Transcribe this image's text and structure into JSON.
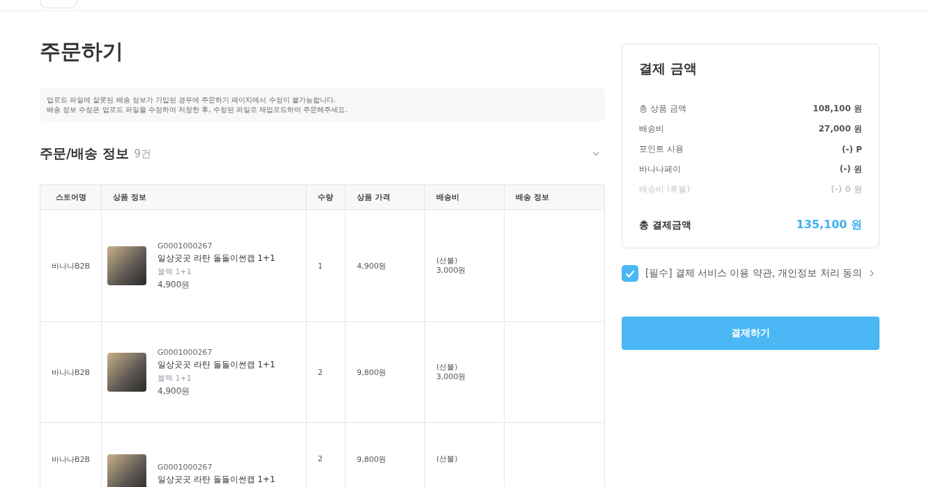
{
  "page_title": "주문하기",
  "notice": [
    "업로드 파일에 잘못된 배송 정보가 기입된 경우에 주문하기 페이지에서 수정이 불가능합니다.",
    "배송 정보 수정은 업로드 파일을 수정하여 저장한 후, 수정된 파일로 재업로드하여 주문해주세요."
  ],
  "section": {
    "title": "주문/배송 정보",
    "count": "9건",
    "expanded": true
  },
  "table": {
    "columns": [
      "스토어명",
      "상품 정보",
      "수량",
      "상품 가격",
      "배송비",
      "배송 정보"
    ],
    "rows": [
      {
        "store": "바나나B2B",
        "code": "G0001000267",
        "name": "일상곳곳 라탄 돌돌이썬캡 1+1",
        "option": "블랙 1+1",
        "unit_price": "4,900원",
        "quantity": "1",
        "price": "4,900원",
        "shipping_type": "(선불)",
        "shipping_fee": "3,000원"
      },
      {
        "store": "바나나B2B",
        "code": "G0001000267",
        "name": "일상곳곳 라탄 돌돌이썬캡 1+1",
        "option": "블랙 1+1",
        "unit_price": "4,900원",
        "quantity": "2",
        "price": "9,800원",
        "shipping_type": "(선불)",
        "shipping_fee": "3,000원"
      },
      {
        "store": "바나나B2B",
        "code": "G0001000267",
        "name": "일상곳곳 라탄 돌돌이썬캡 1+1",
        "quantity": "2",
        "price": "9,800원",
        "shipping_type": "(선불)"
      }
    ]
  },
  "summary": {
    "title": "결제 금액",
    "lines": [
      {
        "label": "총 상품 금액",
        "value": "108,100 원",
        "disabled": false
      },
      {
        "label": "배송비",
        "value": "27,000 원",
        "disabled": false
      },
      {
        "label": "포인트 사용",
        "value": "(-)  P",
        "disabled": false
      },
      {
        "label": "바나나페이",
        "value": "(-)  원",
        "disabled": false
      },
      {
        "label": "배송비 (후불)",
        "value": "(-) 0 원",
        "disabled": true
      }
    ],
    "total_label": "총 결제금액",
    "total_value": "135,100 원"
  },
  "agreement": {
    "label": "[필수] 결제 서비스 이용 약관, 개인정보 처리 동의",
    "checked": true
  },
  "pay_button": "결제하기"
}
